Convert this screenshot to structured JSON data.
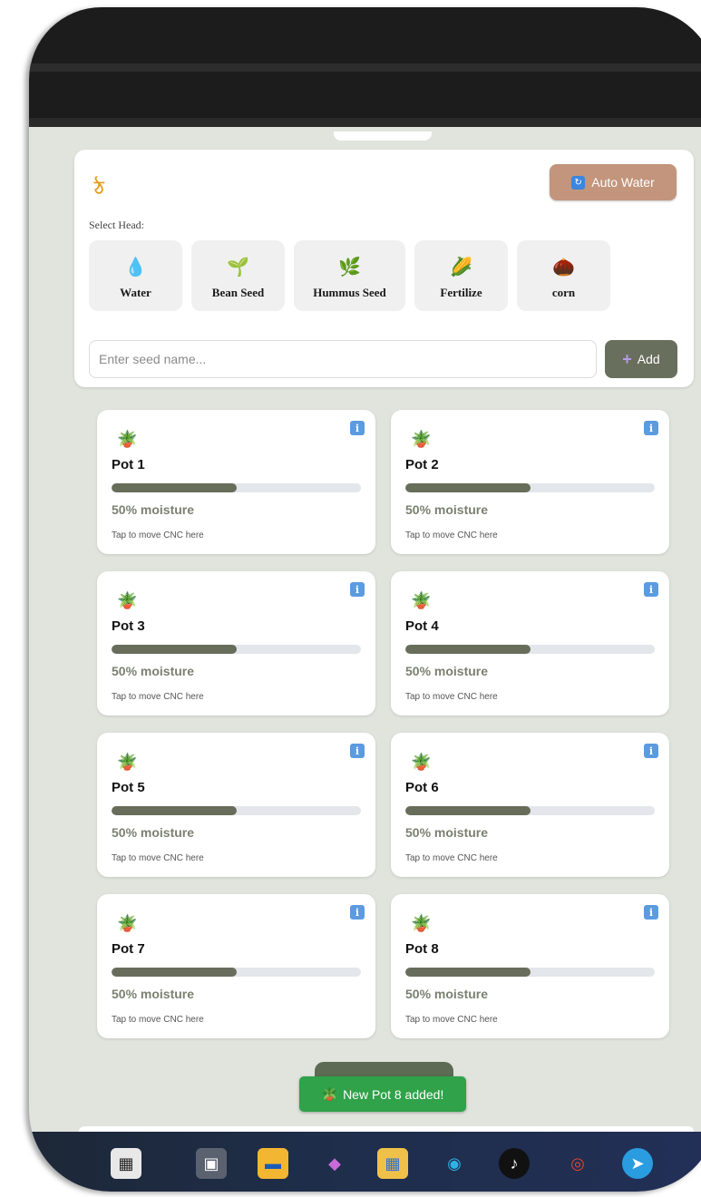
{
  "header": {
    "logo_icon": "ঠ"
  },
  "controls": {
    "auto_water_label": "Auto Water",
    "select_head_label": "Select Head:",
    "heads": [
      {
        "label": "Water",
        "icon": "water-drop-icon",
        "glyph": "💧"
      },
      {
        "label": "Bean Seed",
        "icon": "seedling-icon",
        "glyph": "🌱"
      },
      {
        "label": "Hummus Seed",
        "icon": "herb-icon",
        "glyph": "🌿"
      },
      {
        "label": "Fertilize",
        "icon": "corn-icon",
        "glyph": "🌽"
      },
      {
        "label": "corn",
        "icon": "chestnut-icon",
        "glyph": "🌰"
      }
    ],
    "seed_input_placeholder": "Enter seed name...",
    "add_label": "Add"
  },
  "pots": [
    {
      "name": "Pot 1",
      "moisture": 50,
      "moisture_text": "50% moisture",
      "hint": "Tap to move CNC here"
    },
    {
      "name": "Pot 2",
      "moisture": 50,
      "moisture_text": "50% moisture",
      "hint": "Tap to move CNC here"
    },
    {
      "name": "Pot 3",
      "moisture": 50,
      "moisture_text": "50% moisture",
      "hint": "Tap to move CNC here"
    },
    {
      "name": "Pot 4",
      "moisture": 50,
      "moisture_text": "50% moisture",
      "hint": "Tap to move CNC here"
    },
    {
      "name": "Pot 5",
      "moisture": 50,
      "moisture_text": "50% moisture",
      "hint": "Tap to move CNC here"
    },
    {
      "name": "Pot 6",
      "moisture": 50,
      "moisture_text": "50% moisture",
      "hint": "Tap to move CNC here"
    },
    {
      "name": "Pot 7",
      "moisture": 50,
      "moisture_text": "50% moisture",
      "hint": "Tap to move CNC here"
    },
    {
      "name": "Pot 8",
      "moisture": 50,
      "moisture_text": "50% moisture",
      "hint": "Tap to move CNC here"
    }
  ],
  "toast": {
    "text": "New Pot 8 added!"
  },
  "taskbar": {
    "icons": [
      "sudoku-icon",
      "task-view-icon",
      "file-explorer-icon",
      "copilot-icon",
      "store-icon",
      "edge-icon",
      "tiktok-icon",
      "chrome-icon",
      "telegram-icon"
    ]
  },
  "colors": {
    "accent": "#696f5d",
    "auto_water": "#c2957c",
    "toast": "#2fa24a",
    "background": "#e1e4dd"
  }
}
